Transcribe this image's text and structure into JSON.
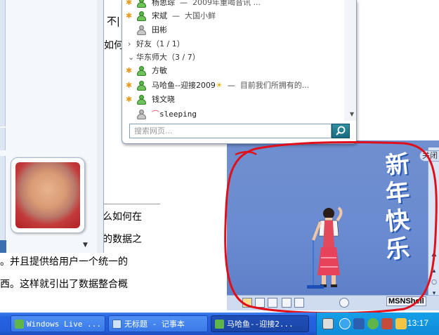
{
  "document": {
    "lines": [
      "不|",
      "如何",
      "么如何在",
      "的数据之",
      "。并且提供给用户一个统一的",
      "西。这样就引出了数据整合概"
    ]
  },
  "messenger": {
    "contacts_top": [
      {
        "name": "杨思琮",
        "message": "2009年重喝音讯 ..."
      },
      {
        "name": "宋斌",
        "message": "大国小鲜"
      },
      {
        "name": "田彬",
        "message": ""
      }
    ],
    "group_friends": "好友（1 / 1）",
    "group_school": "华东师大（3 / 7）",
    "contacts_school": [
      {
        "name": "方敏",
        "message": ""
      },
      {
        "name": "马哈鱼--迎接2009",
        "message": "目前我们所拥有的..."
      },
      {
        "name": "钱文晓",
        "message": ""
      },
      {
        "name": "sleeping",
        "message": ""
      }
    ],
    "dash": "—",
    "search_placeholder": "搜索网页..."
  },
  "overlay": {
    "new_year": [
      "新",
      "年",
      "快",
      "乐"
    ],
    "close_label": "关闭",
    "msnshell_label": "MSNShell"
  },
  "taskbar": {
    "items": [
      {
        "label": "Windows Live ..."
      },
      {
        "label": "无标题 - 记事本"
      },
      {
        "label": "马哈鱼--迎接2..."
      }
    ],
    "clock": "13:17"
  },
  "colors": {
    "taskbar_blue": "#245ddb",
    "tray_blue": "#0f8ad8",
    "annotation_red": "#e0101a",
    "online_green": "#58b447"
  },
  "icons": {
    "online": "person-online-icon",
    "offline": "person-offline-icon",
    "search": "search-icon",
    "sun": "sun-icon",
    "rainbow": "rainbow-icon"
  }
}
